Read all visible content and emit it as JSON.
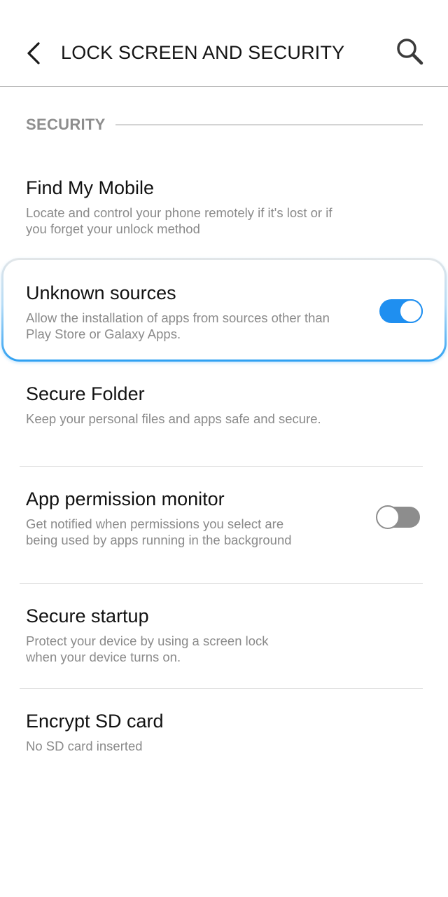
{
  "header": {
    "title": "LOCK SCREEN AND SECURITY",
    "back_icon": "chevron-left-icon",
    "search_icon": "search-icon"
  },
  "section": {
    "label": "SECURITY"
  },
  "items": [
    {
      "title": "Find My Mobile",
      "description": "Locate and control your phone remotely if it's lost or if you forget your unlock method"
    },
    {
      "title": "Unknown sources",
      "description": "Allow the installation of apps from sources other than Play Store or Galaxy Apps.",
      "toggle": "on",
      "highlighted": true
    },
    {
      "title": "Secure Folder",
      "description": "Keep your personal files and apps safe and secure."
    },
    {
      "title": "App permission monitor",
      "description": "Get notified when permissions you select are being used by apps running in the background",
      "toggle": "off"
    },
    {
      "title": "Secure startup",
      "description": "Protect your device by using a screen lock when your device turns on."
    },
    {
      "title": "Encrypt SD card",
      "description": "No SD card inserted"
    }
  ],
  "colors": {
    "accent": "#1f8ff0",
    "toggle_off": "#8d8d8d",
    "section_text": "#8e8e8e",
    "description_text": "#8a8a8a"
  }
}
